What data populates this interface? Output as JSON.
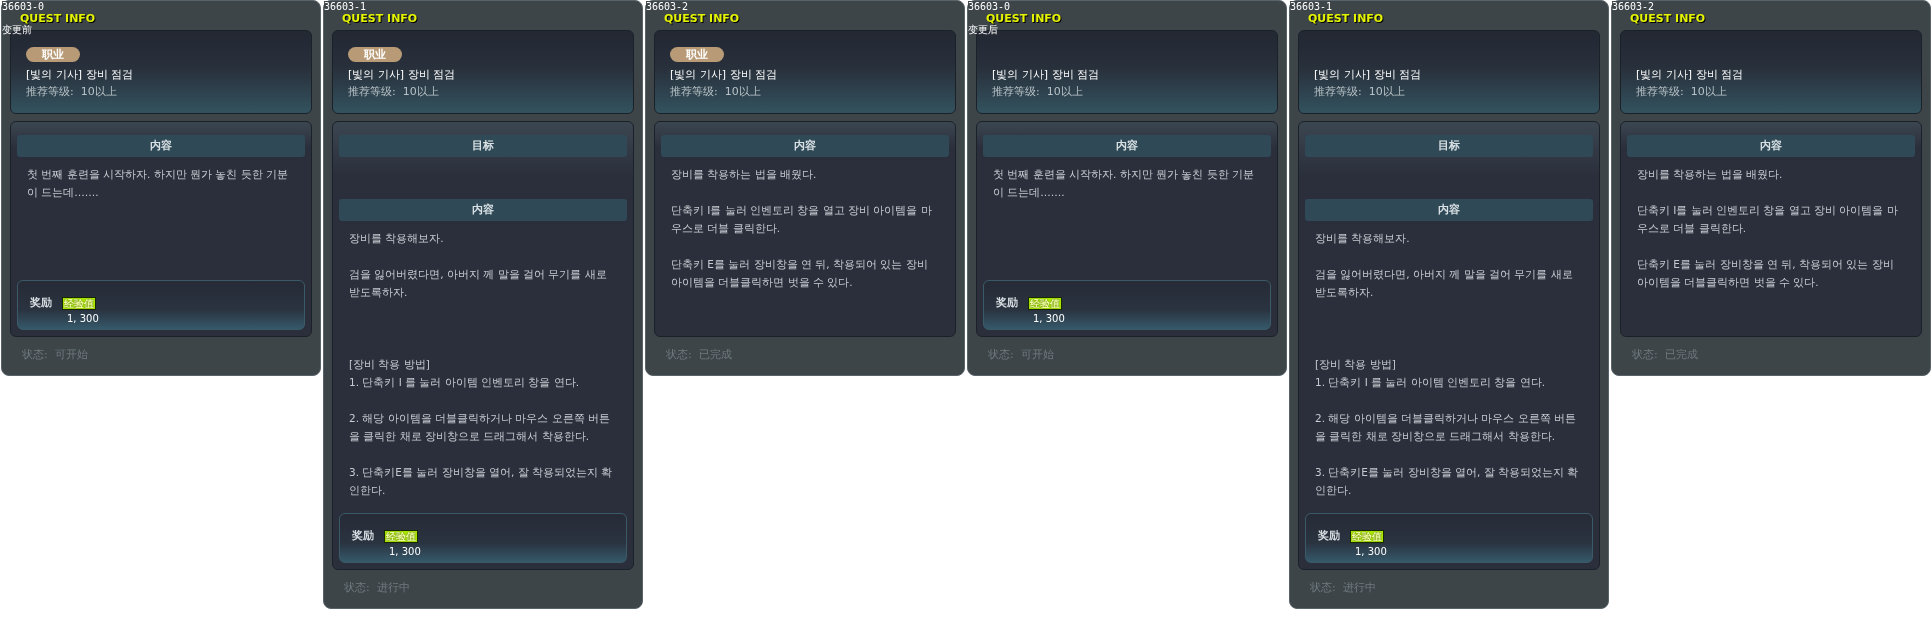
{
  "panels": [
    {
      "id_label": "36603-0",
      "title": "QUEST INFO",
      "note": "变更前",
      "job_badge": "职业",
      "quest_name": "[빛의 기사] 장비 점검",
      "level": "推荐等级:  10以上",
      "sections": [
        {
          "heading": "内容",
          "text": "첫 번째 훈련을 시작하자. 하지만 뭔가 놓친 듯한 기분이 드는데……."
        }
      ],
      "reward": {
        "label": "奖励",
        "type": "经验值",
        "amount": "1, 300"
      },
      "status": "状态:  可开始"
    },
    {
      "id_label": "36603-1",
      "title": "QUEST INFO",
      "job_badge": "职业",
      "quest_name": "[빛의 기사] 장비 점검",
      "level": "推荐等级:  10以上",
      "sections": [
        {
          "heading": "目标"
        },
        {
          "heading": "内容",
          "text": "장비를 착용해보자.\n\n검을 잃어버렸다면, 아버지 께 말을 걸어 무기를 새로 받도록하자.\n\n\n\n[장비 착용 방법]\n1. 단축키 I 를 눌러 아이템 인벤토리 창을 연다.\n\n2. 해당 아이템을 더블클릭하거나 마우스 오른쪽 버튼을 클릭한 채로 장비창으로 드래그해서 착용한다.\n\n3. 단축키E를 눌러 장비창을 열어, 잘 착용되었는지 확인한다."
        }
      ],
      "reward": {
        "label": "奖励",
        "type": "经验值",
        "amount": "1, 300"
      },
      "status": "状态:  进行中"
    },
    {
      "id_label": "36603-2",
      "title": "QUEST INFO",
      "job_badge": "职业",
      "quest_name": "[빛의 기사] 장비 점검",
      "level": "推荐等级:  10以上",
      "sections": [
        {
          "heading": "内容",
          "text": "장비를 착용하는 법을 배웠다.\n\n단축키 I를 눌러 인벤토리 창을 열고 장비 아이템을 마우스로 더블 클릭한다.\n\n단축키 E를 눌러 장비창을 연 뒤, 착용되어 있는 장비 아이템을 더블클릭하면 벗을 수 있다."
        }
      ],
      "status": "状态:  已完成"
    },
    {
      "id_label": "36603-0",
      "title": "QUEST INFO",
      "note": "变更后",
      "quest_name": "[빛의 기사] 장비 점검",
      "level": "推荐等级:  10以上",
      "sections": [
        {
          "heading": "内容",
          "text": "첫 번째 훈련을 시작하자. 하지만 뭔가 놓친 듯한 기분이 드는데……."
        }
      ],
      "reward": {
        "label": "奖励",
        "type": "经验值",
        "amount": "1, 300"
      },
      "status": "状态:  可开始"
    },
    {
      "id_label": "36603-1",
      "title": "QUEST INFO",
      "quest_name": "[빛의 기사] 장비 점검",
      "level": "推荐等级:  10以上",
      "sections": [
        {
          "heading": "目标"
        },
        {
          "heading": "内容",
          "text": "장비를 착용해보자.\n\n검을 잃어버렸다면, 아버지 께 말을 걸어 무기를 새로 받도록하자.\n\n\n\n[장비 착용 방법]\n1. 단축키 I 를 눌러 아이템 인벤토리 창을 연다.\n\n2. 해당 아이템을 더블클릭하거나 마우스 오른쪽 버튼을 클릭한 채로 장비창으로 드래그해서 착용한다.\n\n3. 단축키E를 눌러 장비창을 열어, 잘 착용되었는지 확인한다."
        }
      ],
      "reward": {
        "label": "奖励",
        "type": "经验值",
        "amount": "1, 300"
      },
      "status": "状态:  进行中"
    },
    {
      "id_label": "36603-2",
      "title": "QUEST INFO",
      "quest_name": "[빛의 기사] 장비 점검",
      "level": "推荐等级:  10以上",
      "sections": [
        {
          "heading": "内容",
          "text": "장비를 착용하는 법을 배웠다.\n\n단축키 I를 눌러 인벤토리 창을 열고 장비 아이템을 마우스로 더블 클릭한다.\n\n단축키 E를 눌러 장비창을 연 뒤, 착용되어 있는 장비 아이템을 더블클릭하면 벗을 수 있다."
        }
      ],
      "status": "状态:  已完成"
    }
  ]
}
